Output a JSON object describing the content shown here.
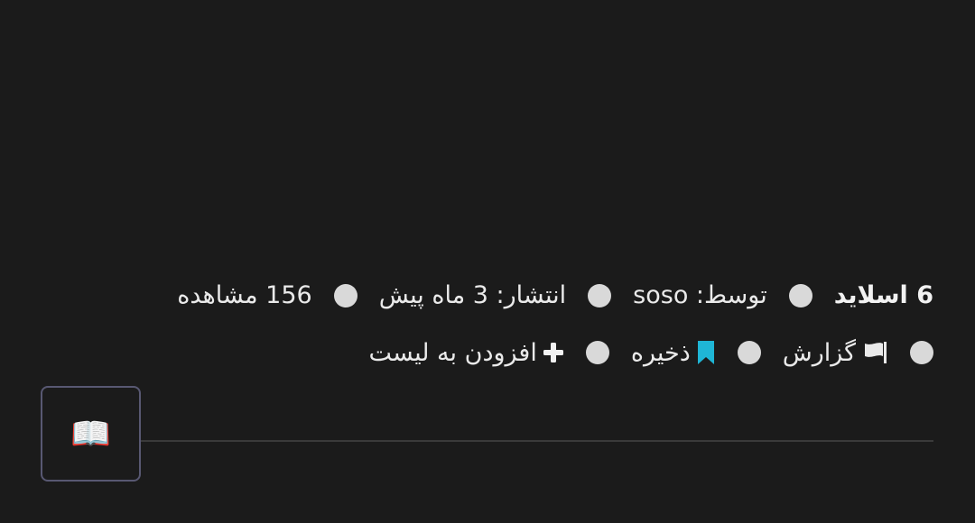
{
  "meta": {
    "slides": "6 اسلاید",
    "author": "توسط: soso",
    "published": "انتشار: 3 ماه پیش",
    "views": "156 مشاهده"
  },
  "actions": {
    "report": "گزارش",
    "save": "ذخیره",
    "add_to_list": "افزودن به لیست"
  },
  "thumbnail": {
    "icon": "open-book-icon",
    "glyph": "📖"
  },
  "colors": {
    "background": "#1b1b1b",
    "bookmark_accent": "#1fb6d6",
    "dot": "#d9d9d9",
    "thumbnail_border": "#585872"
  }
}
